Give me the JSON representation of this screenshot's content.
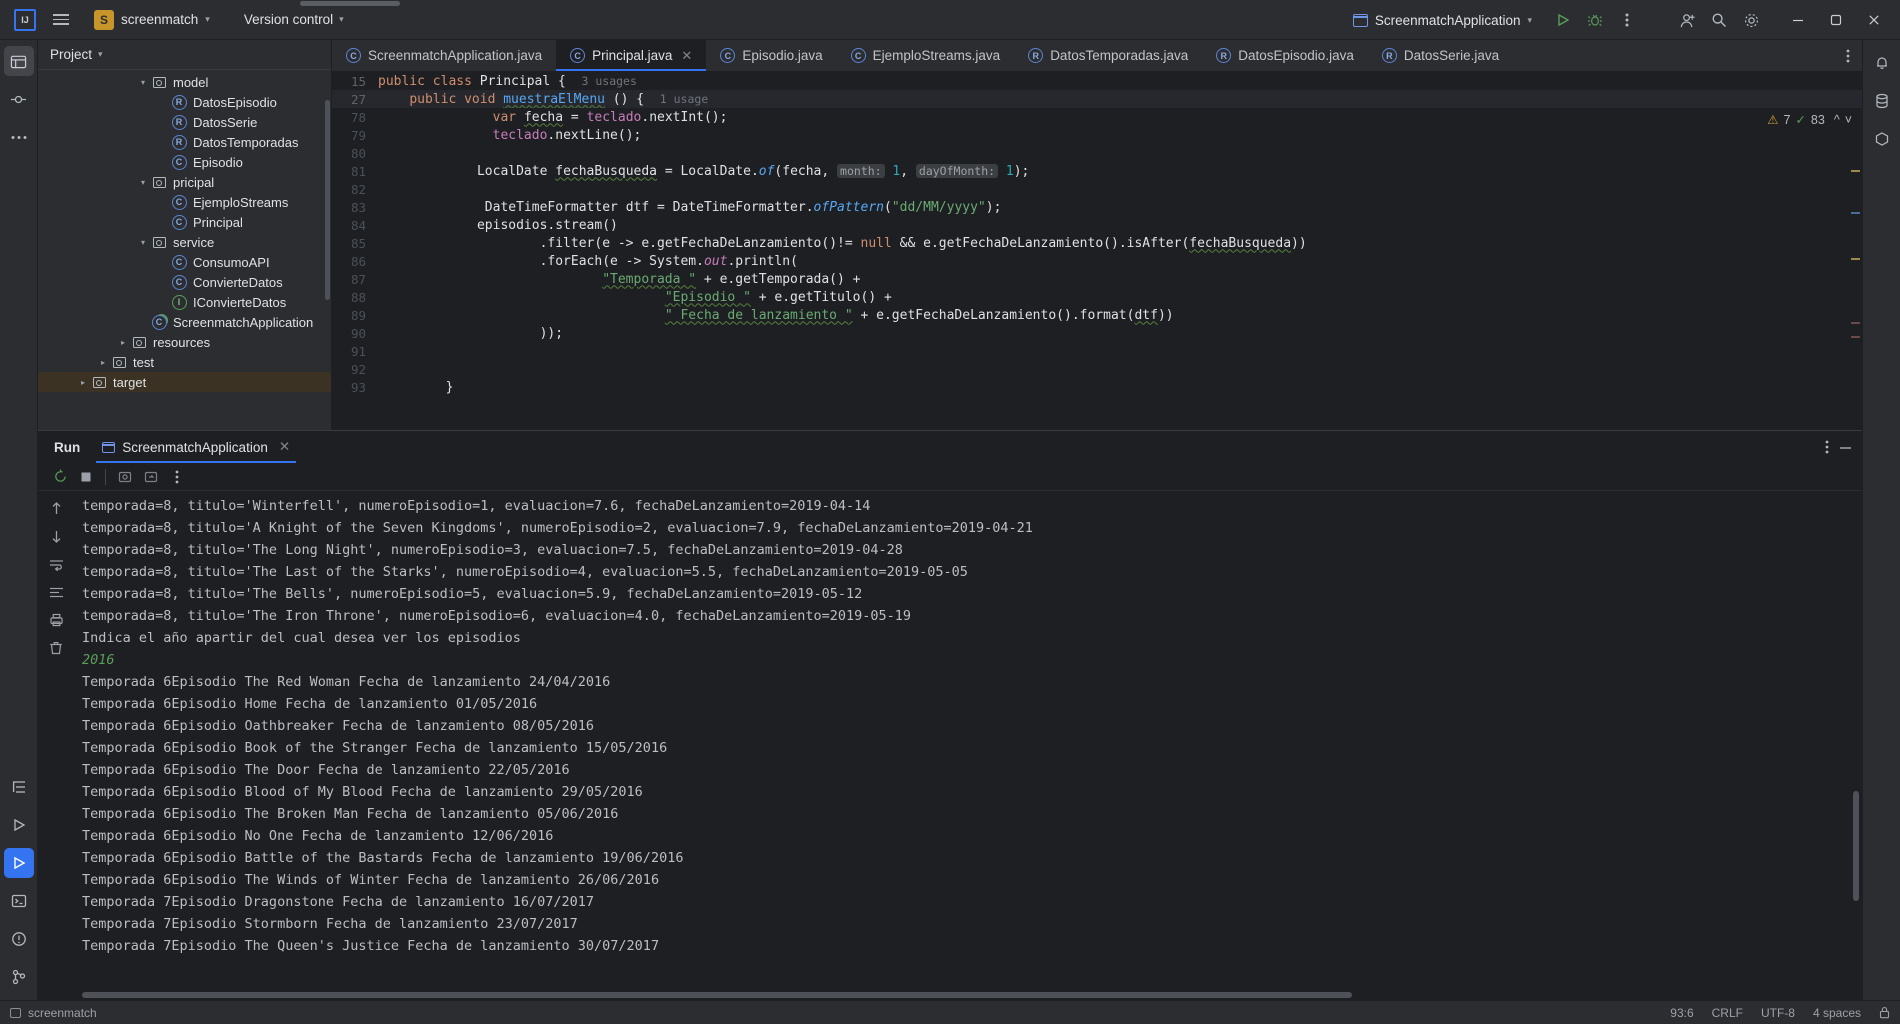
{
  "titlebar": {
    "ij_logo": "IJ",
    "menu_icon": "hamburger-icon",
    "project_badge": "S",
    "project_name": "screenmatch",
    "version_control": "Version control",
    "run_config": "ScreenmatchApplication",
    "run_icon": "run-icon",
    "debug_icon": "debug-icon",
    "more_icon": "more-vertical-icon",
    "account_icon": "account-icon",
    "search_icon": "search-icon",
    "settings_icon": "gear-icon",
    "minimize": "minimize-icon",
    "maximize": "maximize-icon",
    "close": "close-icon"
  },
  "rail": {
    "project_icon": "project-folder-icon",
    "commit_icon": "commit-icon",
    "more_icon": "more-horizontal-icon",
    "structure_icon": "structure-icon",
    "run_icon": "run-icon",
    "debug_icon": "debug-icon",
    "terminal_icon": "terminal-icon",
    "problems_icon": "problems-icon",
    "vcs_icon": "version-control-icon"
  },
  "project_panel": {
    "title": "Project",
    "tree": [
      {
        "label": "model",
        "indent": 4,
        "arrow": "v",
        "icon": "folder",
        "selected": false
      },
      {
        "label": "DatosEpisodio",
        "indent": 5,
        "arrow": "",
        "icon": "record",
        "selected": false
      },
      {
        "label": "DatosSerie",
        "indent": 5,
        "arrow": "",
        "icon": "record",
        "selected": false
      },
      {
        "label": "DatosTemporadas",
        "indent": 5,
        "arrow": "",
        "icon": "record",
        "selected": false
      },
      {
        "label": "Episodio",
        "indent": 5,
        "arrow": "",
        "icon": "class",
        "selected": false
      },
      {
        "label": "pricipal",
        "indent": 4,
        "arrow": "v",
        "icon": "folder",
        "selected": false
      },
      {
        "label": "EjemploStreams",
        "indent": 5,
        "arrow": "",
        "icon": "class",
        "selected": false
      },
      {
        "label": "Principal",
        "indent": 5,
        "arrow": "",
        "icon": "class",
        "selected": false
      },
      {
        "label": "service",
        "indent": 4,
        "arrow": "v",
        "icon": "folder",
        "selected": false
      },
      {
        "label": "ConsumoAPI",
        "indent": 5,
        "arrow": "",
        "icon": "class",
        "selected": false
      },
      {
        "label": "ConvierteDatos",
        "indent": 5,
        "arrow": "",
        "icon": "class",
        "selected": false
      },
      {
        "label": "IConvierteDatos",
        "indent": 5,
        "arrow": "",
        "icon": "iface",
        "selected": false
      },
      {
        "label": "ScreenmatchApplication",
        "indent": 4,
        "arrow": "",
        "icon": "spring",
        "selected": false
      },
      {
        "label": "resources",
        "indent": 3,
        "arrow": ">",
        "icon": "folder",
        "selected": false
      },
      {
        "label": "test",
        "indent": 2,
        "arrow": ">",
        "icon": "folder",
        "selected": false
      },
      {
        "label": "target",
        "indent": 1,
        "arrow": ">",
        "icon": "folder",
        "selected": true
      }
    ]
  },
  "editor": {
    "tabs": [
      {
        "label": "ScreenmatchApplication.java",
        "icon": "class",
        "active": false,
        "closable": false
      },
      {
        "label": "Principal.java",
        "icon": "class",
        "active": true,
        "closable": true
      },
      {
        "label": "Episodio.java",
        "icon": "class",
        "active": false,
        "closable": false
      },
      {
        "label": "EjemploStreams.java",
        "icon": "class",
        "active": false,
        "closable": false
      },
      {
        "label": "DatosTemporadas.java",
        "icon": "record",
        "active": false,
        "closable": false
      },
      {
        "label": "DatosEpisodio.java",
        "icon": "record",
        "active": false,
        "closable": false
      },
      {
        "label": "DatosSerie.java",
        "icon": "record",
        "active": false,
        "closable": false
      }
    ],
    "tabs_more_icon": "more-vertical-icon",
    "sticky": [
      {
        "num": "15",
        "usages": "3 usages"
      },
      {
        "num": "27",
        "usages": "1 usage"
      }
    ],
    "inspection": {
      "warn_icon": "warning-triangle-icon",
      "warn_count": "7",
      "ok_icon": "check-icon",
      "ok_count": "83",
      "up_icon": "chevron-up-icon",
      "down_icon": "chevron-down-icon"
    },
    "lines": [
      {
        "num": "78"
      },
      {
        "num": "79"
      },
      {
        "num": "80"
      },
      {
        "num": "81"
      },
      {
        "num": "82"
      },
      {
        "num": "83"
      },
      {
        "num": "84"
      },
      {
        "num": "85"
      },
      {
        "num": "86"
      },
      {
        "num": "87"
      },
      {
        "num": "88"
      },
      {
        "num": "89"
      },
      {
        "num": "90"
      },
      {
        "num": "91"
      },
      {
        "num": "92"
      },
      {
        "num": "93"
      }
    ]
  },
  "run_panel": {
    "title": "Run",
    "tab_label": "ScreenmatchApplication",
    "tab_close": "close-icon",
    "settings_icon": "more-vertical-icon",
    "minimize_icon": "minimize-icon",
    "toolbar": {
      "rerun": "rerun-icon",
      "stop": "stop-icon",
      "camera": "soft-wrap-icon",
      "export": "export-icon",
      "more": "more-vertical-icon"
    },
    "console_rail": {
      "up": "arrow-up-icon",
      "down": "arrow-down-icon",
      "wrap": "soft-wrap-icon",
      "scroll": "scroll-to-end-icon",
      "print": "print-icon",
      "trash": "trash-icon"
    },
    "console_lines": [
      {
        "text": "temporada=8, titulo='Winterfell', numeroEpisodio=1, evaluacion=7.6, fechaDeLanzamiento=2019-04-14",
        "type": "out"
      },
      {
        "text": "temporada=8, titulo='A Knight of the Seven Kingdoms', numeroEpisodio=2, evaluacion=7.9, fechaDeLanzamiento=2019-04-21",
        "type": "out"
      },
      {
        "text": "temporada=8, titulo='The Long Night', numeroEpisodio=3, evaluacion=7.5, fechaDeLanzamiento=2019-04-28",
        "type": "out"
      },
      {
        "text": "temporada=8, titulo='The Last of the Starks', numeroEpisodio=4, evaluacion=5.5, fechaDeLanzamiento=2019-05-05",
        "type": "out"
      },
      {
        "text": "temporada=8, titulo='The Bells', numeroEpisodio=5, evaluacion=5.9, fechaDeLanzamiento=2019-05-12",
        "type": "out"
      },
      {
        "text": "temporada=8, titulo='The Iron Throne', numeroEpisodio=6, evaluacion=4.0, fechaDeLanzamiento=2019-05-19",
        "type": "out"
      },
      {
        "text": "Indica el año apartir del cual desea ver los episodios",
        "type": "out"
      },
      {
        "text": "2016",
        "type": "input"
      },
      {
        "text": "Temporada 6Episodio The Red Woman Fecha de lanzamiento 24/04/2016",
        "type": "out"
      },
      {
        "text": "Temporada 6Episodio Home Fecha de lanzamiento 01/05/2016",
        "type": "out"
      },
      {
        "text": "Temporada 6Episodio Oathbreaker Fecha de lanzamiento 08/05/2016",
        "type": "out"
      },
      {
        "text": "Temporada 6Episodio Book of the Stranger Fecha de lanzamiento 15/05/2016",
        "type": "out"
      },
      {
        "text": "Temporada 6Episodio The Door Fecha de lanzamiento 22/05/2016",
        "type": "out"
      },
      {
        "text": "Temporada 6Episodio Blood of My Blood Fecha de lanzamiento 29/05/2016",
        "type": "out"
      },
      {
        "text": "Temporada 6Episodio The Broken Man Fecha de lanzamiento 05/06/2016",
        "type": "out"
      },
      {
        "text": "Temporada 6Episodio No One Fecha de lanzamiento 12/06/2016",
        "type": "out"
      },
      {
        "text": "Temporada 6Episodio Battle of the Bastards Fecha de lanzamiento 19/06/2016",
        "type": "out"
      },
      {
        "text": "Temporada 6Episodio The Winds of Winter Fecha de lanzamiento 26/06/2016",
        "type": "out"
      },
      {
        "text": "Temporada 7Episodio Dragonstone Fecha de lanzamiento 16/07/2017",
        "type": "out"
      },
      {
        "text": "Temporada 7Episodio Stormborn Fecha de lanzamiento 23/07/2017",
        "type": "out"
      },
      {
        "text": "Temporada 7Episodio The Queen's Justice Fecha de lanzamiento 30/07/2017",
        "type": "out"
      }
    ]
  },
  "status_bar": {
    "project_icon": "project-icon",
    "project_name": "screenmatch",
    "caret": "93:6",
    "line_separator": "CRLF",
    "encoding": "UTF-8",
    "indent": "4 spaces",
    "lock_icon": "lock-icon"
  },
  "colors": {
    "accent": "#3574f0",
    "brand": "#c8952b",
    "warning": "#d6a13c",
    "success": "#5a9c5a",
    "string": "#6aab73",
    "keyword": "#cf8e6d",
    "number": "#2aacb8"
  }
}
